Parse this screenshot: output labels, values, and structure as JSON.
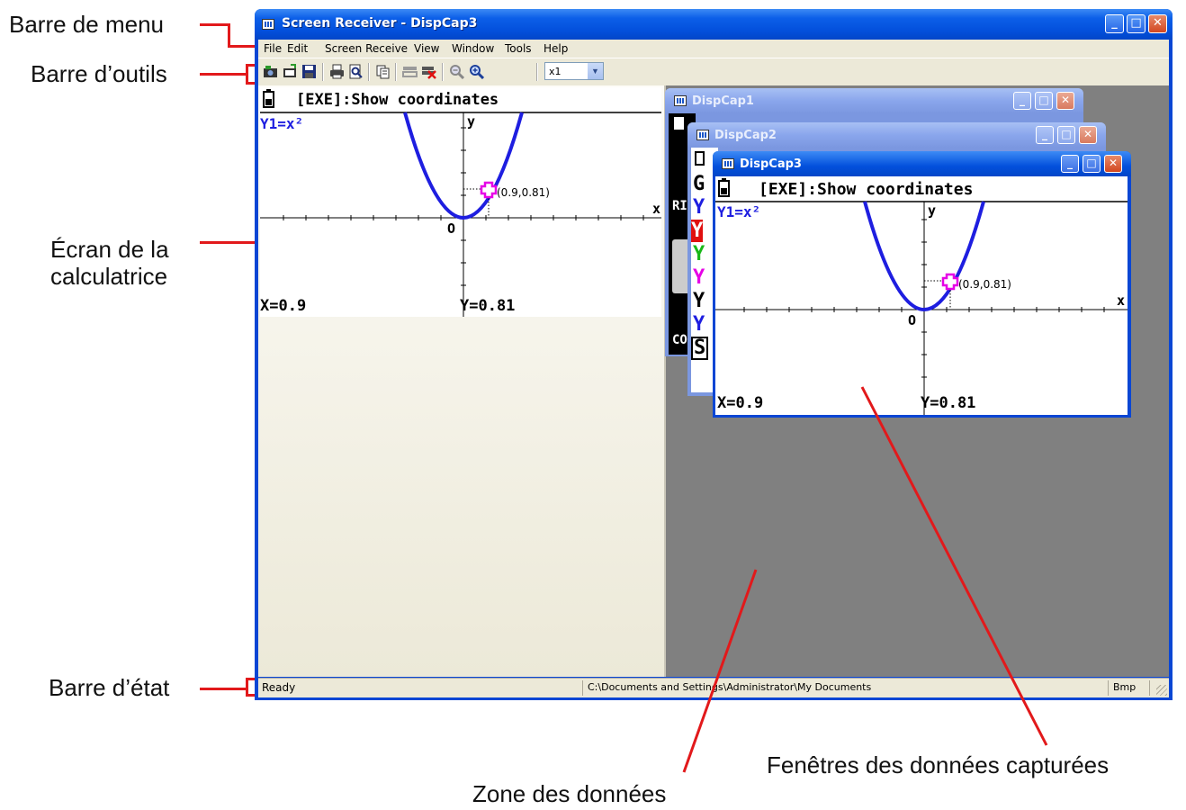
{
  "annotations": {
    "menu_bar": "Barre de menu",
    "toolbar": "Barre d’outils",
    "calc_screen_line1": "Écran de la",
    "calc_screen_line2": "calculatrice",
    "status_bar": "Barre d’état",
    "captured_windows": "Fenêtres des données capturées",
    "data_area": "Zone des données"
  },
  "window": {
    "title": "Screen Receiver - DispCap3",
    "minimize": "_",
    "maximize": "□",
    "close": "✕"
  },
  "menu": [
    "File",
    "Edit",
    "Screen Receive",
    "View",
    "Window",
    "Tools",
    "Help"
  ],
  "toolbar": {
    "icons": [
      "capture-icon",
      "open-icon",
      "save-icon",
      "print-icon",
      "print-preview-icon",
      "copy-icon",
      "receive-icon",
      "stop-receive-icon",
      "zoom-out-icon",
      "zoom-in-icon"
    ],
    "zoom_value": "x1",
    "zoom_arrow": "▼"
  },
  "calculator": {
    "header": "[EXE]:Show coordinates",
    "function": "Y1=x²",
    "axis_y": "y",
    "axis_x": "x",
    "origin": "O",
    "point_label": "(0.9,0.81)",
    "x_readout": "X=0.9",
    "y_readout": "Y=0.81"
  },
  "children": [
    {
      "title": "DispCap1"
    },
    {
      "title": "DispCap2"
    },
    {
      "title": "DispCap3"
    }
  ],
  "dispcap2_partial": {
    "lines": [
      "G",
      "Y",
      "Y",
      "Y",
      "Y",
      "Y",
      "Y",
      "S"
    ]
  },
  "dispcap1_partial": {
    "lines": [
      "RI",
      "CO"
    ]
  },
  "statusbar": {
    "left": "Ready",
    "path": "C:\\Documents and Settings\\Administrator\\My Documents",
    "format": "Bmp"
  },
  "colors": {
    "title_blue": "#0350dc",
    "menu_bg": "#ece9d8",
    "mdi_bg": "#808080",
    "curve": "#1e1ee0",
    "cursor": "#e600e6",
    "annotation": "#e2191b"
  }
}
